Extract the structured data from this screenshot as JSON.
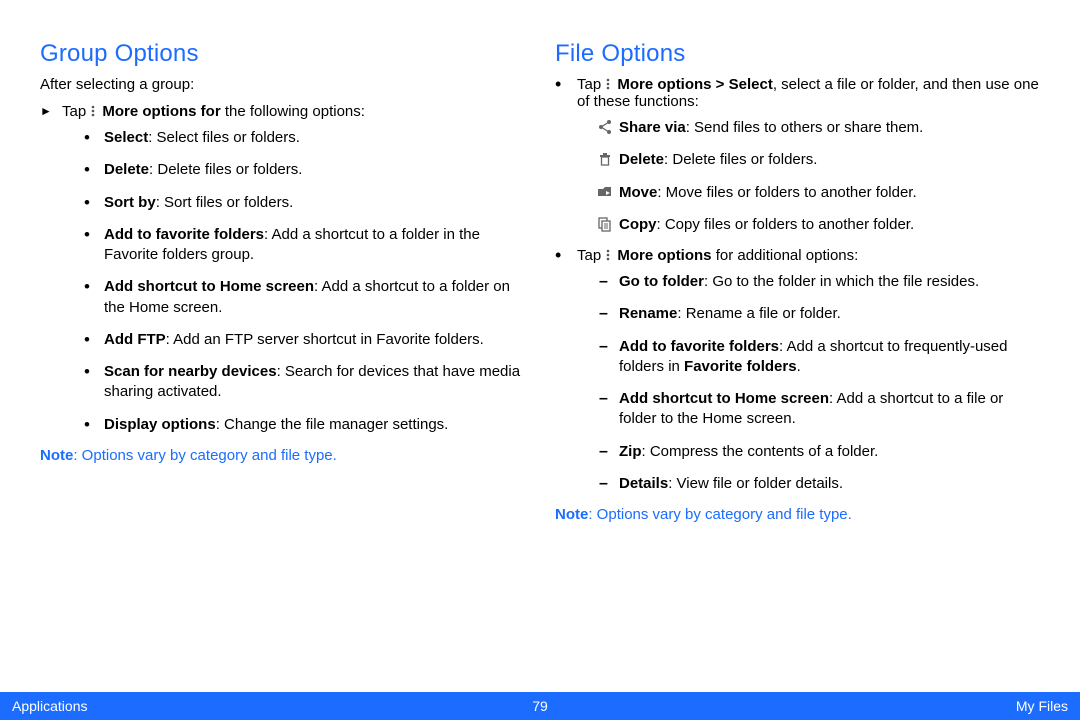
{
  "left": {
    "heading": "Group Options",
    "intro": "After selecting a group:",
    "tap_prefix": "Tap ",
    "more_options_label": "More options for",
    "tap_suffix": " the following options:",
    "items": [
      {
        "label": "Select",
        "desc": ": Select files or folders."
      },
      {
        "label": "Delete",
        "desc": ": Delete files or folders."
      },
      {
        "label": "Sort by",
        "desc": ": Sort files or folders."
      },
      {
        "label": "Add to favorite folders",
        "desc": ": Add a shortcut to a folder in the Favorite folders group."
      },
      {
        "label": "Add shortcut to Home screen",
        "desc": ": Add a shortcut to a folder on the Home screen."
      },
      {
        "label": "Add FTP",
        "desc": ": Add an FTP server shortcut in Favorite folders."
      },
      {
        "label": "Scan for nearby devices",
        "desc": ": Search for devices that have media sharing activated."
      },
      {
        "label": "Display options",
        "desc": ": Change the file manager settings."
      }
    ],
    "note_label": "Note",
    "note_text": ": Options vary by category and file type."
  },
  "right": {
    "heading": "File Options",
    "tap1_prefix": "Tap ",
    "more_select": "More options > Select",
    "tap1_suffix": ", select a file or folder, and then use one of these functions:",
    "iconitems": [
      {
        "icon": "share",
        "label": "Share via",
        "desc": ": Send files to others or share them."
      },
      {
        "icon": "trash",
        "label": "Delete",
        "desc": ": Delete files or folders."
      },
      {
        "icon": "move",
        "label": "Move",
        "desc": ": Move files or folders to another folder."
      },
      {
        "icon": "copy",
        "label": "Copy",
        "desc": ": Copy files or folders to another folder."
      }
    ],
    "tap2_prefix": "Tap ",
    "more_opts": "More options",
    "tap2_suffix": " for additional options:",
    "subitems": [
      {
        "label": "Go to folder",
        "desc": ": Go to the folder in which the file resides."
      },
      {
        "label": "Rename",
        "desc": ": Rename a file or folder."
      },
      {
        "label": "Add to favorite folders",
        "desc_pre": ": Add a shortcut to frequently-used folders in ",
        "bold_tail": "Favorite folders",
        "desc_post": "."
      },
      {
        "label": "Add shortcut to Home screen",
        "desc": ": Add a shortcut to a file or folder to the Home screen."
      },
      {
        "label": "Zip",
        "desc": ": Compress the contents of a folder."
      },
      {
        "label": "Details",
        "desc": ": View file or folder details."
      }
    ],
    "note_label": "Note",
    "note_text": ": Options vary by category and file type."
  },
  "footer": {
    "left": "Applications",
    "center": "79",
    "right": "My Files"
  }
}
